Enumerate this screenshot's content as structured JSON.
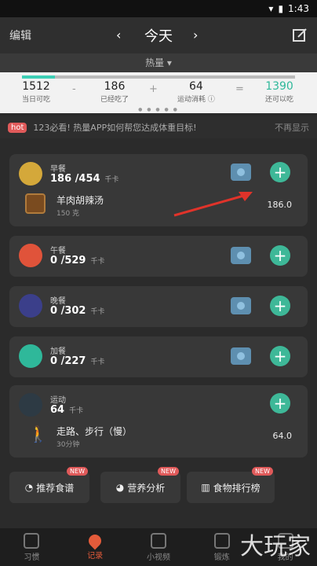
{
  "status": {
    "time": "1:43"
  },
  "header": {
    "edit_label": "编辑",
    "title": "今天",
    "prev": "‹",
    "next": "›"
  },
  "heat": {
    "label": "热量 ▾"
  },
  "summary": {
    "budget": {
      "value": "1512",
      "label": "当日可吃"
    },
    "eaten": {
      "value": "186",
      "label": "已经吃了"
    },
    "exercise": {
      "value": "64",
      "label": "运动消耗 ⓘ"
    },
    "remaining": {
      "value": "1390",
      "label": "还可以吃"
    },
    "minus": "-",
    "plus": "+",
    "equals": "=",
    "progress": 0.12,
    "dots": "● ● ● ● ●"
  },
  "banner": {
    "badge": "hot",
    "message": "123必看! 热量APP如何帮您达成体重目标!",
    "dismiss": "不再显示"
  },
  "meals": [
    {
      "name": "早餐",
      "kcal": "186 /454",
      "unit": "千卡",
      "color": "#d4a83a",
      "food": {
        "name": "羊肉胡辣汤",
        "amount": "150 克",
        "value": "186.0"
      }
    },
    {
      "name": "午餐",
      "kcal": "0 /529",
      "unit": "千卡",
      "color": "#e0533a"
    },
    {
      "name": "晚餐",
      "kcal": "0 /302",
      "unit": "千卡",
      "color": "#3b3f8a"
    },
    {
      "name": "加餐",
      "kcal": "0 /227",
      "unit": "千卡",
      "color": "#2fb89a"
    },
    {
      "name": "运动",
      "kcal": "64",
      "unit": "千卡",
      "color": "#2d3a44",
      "food": {
        "name": "走路、步行（慢）",
        "amount": "30分钟",
        "value": "64.0"
      }
    }
  ],
  "quick_buttons": [
    {
      "label": "推荐食谱",
      "badge": "NEW"
    },
    {
      "label": "营养分析",
      "badge": "NEW"
    },
    {
      "label": "食物排行榜",
      "badge": "NEW"
    }
  ],
  "tabs": [
    {
      "label": "习惯"
    },
    {
      "label": "记录"
    },
    {
      "label": "小视频"
    },
    {
      "label": "锻炼"
    },
    {
      "label": "我的"
    }
  ],
  "watermark": "大玩家",
  "colors": {
    "accent": "#3eb898",
    "tab_active": "#e45b3a",
    "remaining": "#3ecfb5"
  }
}
